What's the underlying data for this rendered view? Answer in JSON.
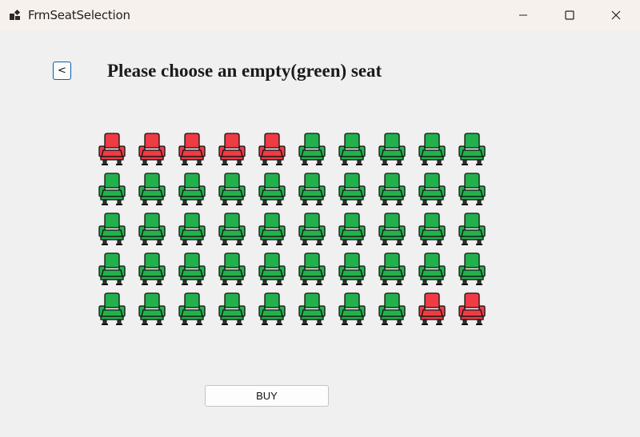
{
  "window": {
    "title": "FrmSeatSelection",
    "controls": {
      "minimize": "minimize-icon",
      "maximize": "maximize-icon",
      "close": "close-icon"
    }
  },
  "header": {
    "back_label": "<",
    "heading": "Please choose an empty(green) seat"
  },
  "seats": {
    "legend": {
      "empty": "green",
      "taken": "red"
    },
    "colors": {
      "empty_fill": "#22b14c",
      "taken_fill": "#ee3b45",
      "outline": "#111111",
      "legs": "#333333"
    },
    "rows": [
      [
        "taken",
        "taken",
        "taken",
        "taken",
        "taken",
        "empty",
        "empty",
        "empty",
        "empty",
        "empty"
      ],
      [
        "empty",
        "empty",
        "empty",
        "empty",
        "empty",
        "empty",
        "empty",
        "empty",
        "empty",
        "empty"
      ],
      [
        "empty",
        "empty",
        "empty",
        "empty",
        "empty",
        "empty",
        "empty",
        "empty",
        "empty",
        "empty"
      ],
      [
        "empty",
        "empty",
        "empty",
        "empty",
        "empty",
        "empty",
        "empty",
        "empty",
        "empty",
        "empty"
      ],
      [
        "empty",
        "empty",
        "empty",
        "empty",
        "empty",
        "empty",
        "empty",
        "empty",
        "taken",
        "taken"
      ]
    ]
  },
  "actions": {
    "buy_label": "BUY"
  }
}
